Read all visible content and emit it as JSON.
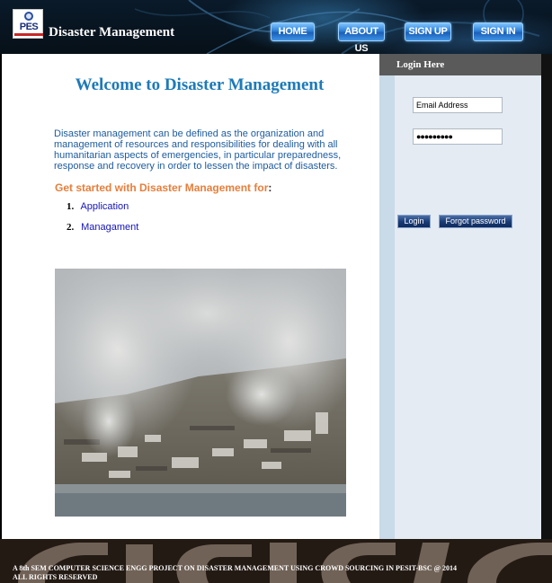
{
  "header": {
    "logo_text": "PES",
    "site_title": "Disaster Management",
    "nav": [
      {
        "label": "HOME"
      },
      {
        "label": "ABOUT US"
      },
      {
        "label": "SIGN UP"
      },
      {
        "label": "SIGN IN"
      }
    ]
  },
  "main": {
    "welcome": "Welcome to Disaster Management",
    "intro": "Disaster management can be defined as the organization and management of resources and responsibilities for dealing with all humanitarian aspects of emergencies, in particular preparedness, response and recovery in order to lessen the impact of disasters.",
    "get_started": "Get started with Disaster Management for",
    "get_started_colon": ":",
    "links": [
      {
        "num": "1.",
        "label": "Application"
      },
      {
        "num": "2.",
        "label": "Managament"
      }
    ]
  },
  "sidebar": {
    "header": "Login Here",
    "email_value": "Email Address",
    "password_value": "●●●●●●●●●",
    "login_label": "Login",
    "forgot_label": "Forgot password"
  },
  "footer": {
    "line1": "A 8th SEM COMPUTER SCIENCE ENGG PROJECT ON DISASTER MANAGEMENT USING CROWD SOURCING IN PESIT-BSC @ 2014",
    "line2": "ALL RIGHTS RESERVED"
  },
  "colors": {
    "title_blue": "#1d7ab8",
    "accent_orange": "#e77e3a",
    "link_blue": "#1414b8",
    "sidebar_bg": "#c9dae9"
  }
}
